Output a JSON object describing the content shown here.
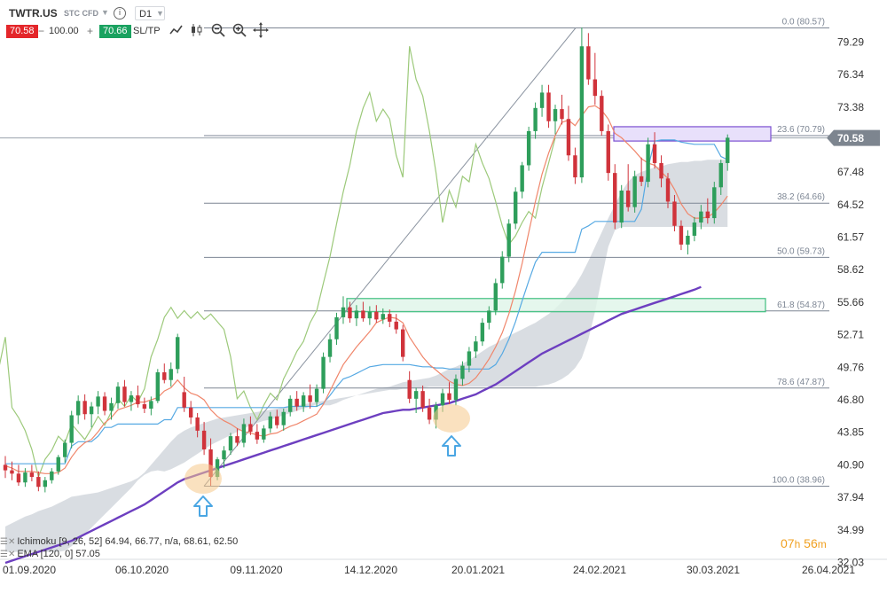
{
  "header": {
    "symbol": "TWTR.US",
    "instrument_type": "STC CFD",
    "timeframe": "D1",
    "bid": "70.58",
    "quantity": "100.00",
    "ask": "70.66",
    "sltp_label": "SL/TP",
    "icons": [
      "line-chart-icon",
      "candlestick-icon",
      "zoom-out-icon",
      "zoom-in-icon",
      "crosshair-icon"
    ]
  },
  "indicators": {
    "ichimoku": "Ichimoku [9, 26, 52] 64.94, 66.77, n/a, 68.61, 62.50",
    "ema": "EMA [120, 0] 57.05"
  },
  "timer": {
    "hours": "07",
    "h_unit": "h",
    "minutes": "56",
    "m_unit": "m"
  },
  "colors": {
    "bull": "#2e9e5b",
    "bear": "#d0333b",
    "tenkan": "#f0866b",
    "kijun": "#56a9e3",
    "chikou": "#9cc97a",
    "ema": "#6d3fc0",
    "cloud": "#c9cfd6",
    "fib": "#7d8694",
    "green_zone": "#3fbf7f",
    "purple_zone": "#7b4fd1",
    "price_tag": "#7d858f",
    "marker": "#f5c98a",
    "arrow": "#4aa6e3"
  },
  "chart_data": {
    "type": "candlestick",
    "title": "",
    "y_ticks": [
      79.29,
      76.34,
      73.38,
      70.43,
      67.48,
      64.52,
      61.57,
      58.62,
      55.66,
      52.71,
      49.76,
      46.8,
      43.85,
      40.9,
      37.94,
      34.99,
      32.03
    ],
    "x_ticks": [
      "01.09.2020",
      "06.10.2020",
      "09.11.2020",
      "14.12.2020",
      "20.01.2021",
      "24.02.2021",
      "30.03.2021",
      "26.04.2021"
    ],
    "ylim": [
      31.0,
      81.5
    ],
    "current_price": "70.58",
    "fibonacci": [
      {
        "level": "0.0",
        "price": "80.57"
      },
      {
        "level": "23.6",
        "price": "70.79"
      },
      {
        "level": "38.2",
        "price": "64.66"
      },
      {
        "level": "50.0",
        "price": "59.73"
      },
      {
        "level": "61.8",
        "price": "54.87"
      },
      {
        "level": "78.6",
        "price": "47.87"
      },
      {
        "level": "100.0",
        "price": "38.96"
      }
    ],
    "zones": [
      {
        "name": "supply",
        "from": 70.3,
        "to": 71.6
      },
      {
        "name": "support",
        "from": 54.8,
        "to": 56.0
      }
    ],
    "candles": [
      [
        40.9,
        41.7,
        39.7,
        40.4
      ],
      [
        40.4,
        41.2,
        39.5,
        40.1
      ],
      [
        40.1,
        40.9,
        39.0,
        39.3
      ],
      [
        39.3,
        40.6,
        38.9,
        40.2
      ],
      [
        40.2,
        40.9,
        39.4,
        39.8
      ],
      [
        39.8,
        40.3,
        38.5,
        38.9
      ],
      [
        38.9,
        39.8,
        38.4,
        39.5
      ],
      [
        39.5,
        40.6,
        39.2,
        40.3
      ],
      [
        40.3,
        41.8,
        40.0,
        41.6
      ],
      [
        41.6,
        43.2,
        41.1,
        42.9
      ],
      [
        42.9,
        45.8,
        42.4,
        45.4
      ],
      [
        45.4,
        47.2,
        44.6,
        46.7
      ],
      [
        46.7,
        47.3,
        45.0,
        45.5
      ],
      [
        45.5,
        46.6,
        44.3,
        46.2
      ],
      [
        46.2,
        47.6,
        45.5,
        47.1
      ],
      [
        47.1,
        47.5,
        45.4,
        45.8
      ],
      [
        45.8,
        47.0,
        45.0,
        46.5
      ],
      [
        46.5,
        48.4,
        46.0,
        48.0
      ],
      [
        48.0,
        48.6,
        46.2,
        46.6
      ],
      [
        46.6,
        47.6,
        45.8,
        47.2
      ],
      [
        47.2,
        48.1,
        46.1,
        46.4
      ],
      [
        46.4,
        47.0,
        45.6,
        46.0
      ],
      [
        46.0,
        47.1,
        45.4,
        46.7
      ],
      [
        46.7,
        49.6,
        46.5,
        49.3
      ],
      [
        49.3,
        50.1,
        48.3,
        48.6
      ],
      [
        48.6,
        50.2,
        48.0,
        49.6
      ],
      [
        49.6,
        52.8,
        49.2,
        52.5
      ],
      [
        47.5,
        48.9,
        45.7,
        46.1
      ],
      [
        46.1,
        46.7,
        44.6,
        45.2
      ],
      [
        45.2,
        45.6,
        43.4,
        44.0
      ],
      [
        44.0,
        44.8,
        41.8,
        42.3
      ],
      [
        42.3,
        43.3,
        39.0,
        39.8
      ],
      [
        39.8,
        41.6,
        39.5,
        41.4
      ],
      [
        41.4,
        42.6,
        40.6,
        42.2
      ],
      [
        42.2,
        43.8,
        41.8,
        43.5
      ],
      [
        43.5,
        44.2,
        42.6,
        42.9
      ],
      [
        42.9,
        45.1,
        42.5,
        44.6
      ],
      [
        44.6,
        45.3,
        43.6,
        43.9
      ],
      [
        43.9,
        44.6,
        42.8,
        43.2
      ],
      [
        43.2,
        44.5,
        42.9,
        44.2
      ],
      [
        44.2,
        45.7,
        43.8,
        45.3
      ],
      [
        45.3,
        45.9,
        44.2,
        44.5
      ],
      [
        44.5,
        46.0,
        44.0,
        45.7
      ],
      [
        45.7,
        47.2,
        45.3,
        46.9
      ],
      [
        46.9,
        47.6,
        45.8,
        46.2
      ],
      [
        46.2,
        47.5,
        45.7,
        47.2
      ],
      [
        47.2,
        48.2,
        46.0,
        46.6
      ],
      [
        46.6,
        48.2,
        46.2,
        47.8
      ],
      [
        47.8,
        51.1,
        47.4,
        50.7
      ],
      [
        50.7,
        52.8,
        50.2,
        52.3
      ],
      [
        52.3,
        54.7,
        51.8,
        54.3
      ],
      [
        54.3,
        56.2,
        53.7,
        55.2
      ],
      [
        55.2,
        55.7,
        53.8,
        54.2
      ],
      [
        54.2,
        55.4,
        53.5,
        54.9
      ],
      [
        54.9,
        55.7,
        53.9,
        54.2
      ],
      [
        54.2,
        55.3,
        53.6,
        54.8
      ],
      [
        54.8,
        55.4,
        53.8,
        54.1
      ],
      [
        54.1,
        55.1,
        53.7,
        54.6
      ],
      [
        54.6,
        55.0,
        53.4,
        53.9
      ],
      [
        53.9,
        54.6,
        52.8,
        53.2
      ],
      [
        53.2,
        53.6,
        50.3,
        50.7
      ],
      [
        48.6,
        49.4,
        46.5,
        46.9
      ],
      [
        46.9,
        47.9,
        45.6,
        47.6
      ],
      [
        47.6,
        48.1,
        45.7,
        46.1
      ],
      [
        46.1,
        46.9,
        44.6,
        45.0
      ],
      [
        45.0,
        46.6,
        44.2,
        46.3
      ],
      [
        46.3,
        47.8,
        45.7,
        47.4
      ],
      [
        47.4,
        48.4,
        46.4,
        46.8
      ],
      [
        46.8,
        49.1,
        46.3,
        48.7
      ],
      [
        48.7,
        50.3,
        48.1,
        49.9
      ],
      [
        49.9,
        51.6,
        49.3,
        51.2
      ],
      [
        51.2,
        52.6,
        50.6,
        52.1
      ],
      [
        52.1,
        54.2,
        51.7,
        53.8
      ],
      [
        53.8,
        55.3,
        53.2,
        54.9
      ],
      [
        54.9,
        57.8,
        54.5,
        57.4
      ],
      [
        57.4,
        60.3,
        56.9,
        59.8
      ],
      [
        59.8,
        63.2,
        59.3,
        62.8
      ],
      [
        62.8,
        66.1,
        62.3,
        65.7
      ],
      [
        65.7,
        68.4,
        65.1,
        68.1
      ],
      [
        68.1,
        71.6,
        67.6,
        71.2
      ],
      [
        71.2,
        73.8,
        70.5,
        73.3
      ],
      [
        73.3,
        75.4,
        72.5,
        74.7
      ],
      [
        74.7,
        75.4,
        71.5,
        72.1
      ],
      [
        72.1,
        73.6,
        70.9,
        73.2
      ],
      [
        73.2,
        74.5,
        71.8,
        72.3
      ],
      [
        72.3,
        73.5,
        68.5,
        69.0
      ],
      [
        69.0,
        69.7,
        66.4,
        67.0
      ],
      [
        67.0,
        80.6,
        66.5,
        78.9
      ],
      [
        78.9,
        80.1,
        75.4,
        75.9
      ],
      [
        75.9,
        78.3,
        73.6,
        74.4
      ],
      [
        74.4,
        74.9,
        70.8,
        71.2
      ],
      [
        71.2,
        71.8,
        66.7,
        67.4
      ],
      [
        67.4,
        68.2,
        62.3,
        62.9
      ],
      [
        62.9,
        66.3,
        62.4,
        65.8
      ],
      [
        65.8,
        68.2,
        63.9,
        64.3
      ],
      [
        64.3,
        67.6,
        63.8,
        67.1
      ],
      [
        67.1,
        68.8,
        66.2,
        66.6
      ],
      [
        66.6,
        70.6,
        66.1,
        70.0
      ],
      [
        70.0,
        71.1,
        67.8,
        68.3
      ],
      [
        68.3,
        69.0,
        66.1,
        66.9
      ],
      [
        66.9,
        67.4,
        64.2,
        64.8
      ],
      [
        64.8,
        65.4,
        62.1,
        62.6
      ],
      [
        62.6,
        63.1,
        60.4,
        60.9
      ],
      [
        60.9,
        62.2,
        60.0,
        61.7
      ],
      [
        61.7,
        63.4,
        61.2,
        62.9
      ],
      [
        62.9,
        64.5,
        62.3,
        63.9
      ],
      [
        63.9,
        65.1,
        62.8,
        63.3
      ],
      [
        63.3,
        66.6,
        62.8,
        66.1
      ],
      [
        66.1,
        68.6,
        65.4,
        68.3
      ],
      [
        68.3,
        70.9,
        67.6,
        70.6
      ]
    ],
    "tenkan": [
      40.8,
      40.6,
      40.3,
      40.3,
      40.3,
      40.2,
      40.1,
      40.1,
      40.2,
      40.6,
      41.6,
      42.4,
      42.9,
      43.2,
      43.9,
      44.7,
      45.2,
      45.9,
      46.1,
      46.3,
      46.6,
      46.6,
      46.8,
      47.0,
      47.6,
      47.9,
      48.6,
      47.9,
      47.4,
      47.2,
      46.8,
      45.9,
      45.3,
      44.9,
      44.6,
      44.2,
      43.9,
      43.8,
      43.6,
      43.5,
      43.7,
      43.8,
      44.1,
      44.4,
      44.6,
      44.9,
      45.2,
      45.5,
      46.4,
      47.6,
      48.8,
      50.0,
      50.8,
      51.6,
      52.3,
      53.0,
      53.8,
      54.1,
      54.3,
      54.2,
      53.8,
      52.5,
      51.6,
      50.7,
      50.0,
      49.5,
      49.0,
      48.5,
      48.2,
      48.1,
      48.3,
      48.8,
      49.6,
      50.5,
      51.6,
      52.9,
      54.6,
      56.7,
      59.2,
      62.0,
      64.8,
      67.3,
      69.2,
      70.8,
      72.0,
      72.2,
      71.7,
      72.6,
      73.4,
      73.5,
      73.1,
      72.3,
      71.0,
      70.6,
      70.0,
      69.4,
      68.7,
      68.3,
      68.1,
      67.5,
      66.9,
      65.9,
      64.6,
      63.7,
      63.3,
      63.3,
      63.4,
      63.8,
      64.5,
      65.3
    ],
    "kijun": [
      41.0,
      41.0,
      41.0,
      41.0,
      41.0,
      41.0,
      41.0,
      41.0,
      41.0,
      41.0,
      42.6,
      43.0,
      43.0,
      43.0,
      43.5,
      44.3,
      44.3,
      44.6,
      44.6,
      44.6,
      44.6,
      44.6,
      44.6,
      44.6,
      45.0,
      45.0,
      46.1,
      46.1,
      46.1,
      46.1,
      46.1,
      46.1,
      46.1,
      46.1,
      46.1,
      46.1,
      46.1,
      46.1,
      46.1,
      46.1,
      46.1,
      46.1,
      46.1,
      46.2,
      46.2,
      46.2,
      46.2,
      46.2,
      46.5,
      47.2,
      48.0,
      48.7,
      48.9,
      49.2,
      49.5,
      49.8,
      49.9,
      50.0,
      50.0,
      50.0,
      50.0,
      50.0,
      49.9,
      49.8,
      49.8,
      49.7,
      49.7,
      49.6,
      49.6,
      49.6,
      49.6,
      49.6,
      49.6,
      49.6,
      50.0,
      51.0,
      52.3,
      53.9,
      55.8,
      57.6,
      59.3,
      60.2,
      60.2,
      60.2,
      60.2,
      60.2,
      60.2,
      62.3,
      62.6,
      63.0,
      63.0,
      63.0,
      63.0,
      63.0,
      63.0,
      63.0,
      64.1,
      67.9,
      70.3,
      70.4,
      70.4,
      70.4,
      70.2,
      70.1,
      70.0,
      70.0,
      70.0,
      70.0,
      68.9,
      68.6
    ],
    "chikou": [
      40.4,
      40.1,
      39.3,
      40.2,
      39.8,
      38.9,
      39.5,
      40.3,
      41.6,
      42.9,
      45.4,
      46.7,
      45.5,
      46.2,
      47.1,
      45.8,
      46.5,
      48.0,
      46.6,
      47.2,
      46.4,
      46.0,
      46.7,
      49.3,
      48.6,
      49.6,
      52.5,
      46.1,
      45.2,
      44.0,
      42.3,
      39.8,
      41.4,
      42.2,
      43.5,
      42.9,
      44.6,
      43.9,
      43.2,
      44.2,
      45.3,
      44.5,
      45.7,
      46.9,
      46.2,
      47.2,
      46.6,
      47.8,
      50.7,
      52.3,
      54.3,
      55.2,
      54.2,
      54.9,
      54.2,
      54.8,
      54.1,
      54.6,
      53.9,
      53.2,
      50.7,
      46.9,
      47.6,
      46.1,
      45.0,
      46.3,
      47.4,
      46.8,
      48.7,
      49.9,
      51.2,
      52.1,
      53.8,
      54.9,
      57.4,
      59.8,
      62.8,
      65.7,
      68.1,
      71.2,
      73.3,
      74.7,
      72.1,
      73.2,
      72.3,
      69.0,
      67.0,
      78.9,
      75.9,
      74.4,
      71.2,
      67.4,
      62.9,
      65.8,
      64.3,
      67.1,
      66.6,
      70.0,
      68.3,
      66.9,
      64.8,
      62.6,
      60.9,
      61.7,
      62.9,
      63.9,
      63.3,
      66.1,
      68.3,
      70.6
    ],
    "span_a": [
      35.3,
      35.6,
      35.9,
      36.2,
      36.4,
      36.7,
      36.9,
      37.1,
      37.4,
      37.7,
      38.0,
      38.1,
      38.2,
      38.3,
      38.4,
      38.6,
      38.8,
      39.0,
      39.2,
      39.4,
      39.7,
      40.0,
      40.3,
      40.4,
      40.3,
      40.5,
      40.8,
      41.1,
      41.5,
      41.9,
      42.3,
      42.7,
      43.0,
      43.3,
      43.6,
      43.9,
      44.2,
      44.5,
      44.7,
      44.9,
      45.0,
      45.2,
      45.4,
      45.6,
      45.8,
      46.0,
      46.2,
      46.4,
      46.3,
      46.3,
      46.5,
      46.8,
      47.0,
      47.2,
      47.4,
      47.6,
      47.8,
      47.9,
      48.0,
      48.2,
      48.4,
      48.5,
      48.6,
      48.7,
      48.8,
      49.0,
      49.3,
      49.6,
      49.8,
      50.1,
      50.4,
      50.8,
      51.2,
      51.6,
      51.9,
      52.3,
      52.6,
      52.9,
      53.2,
      53.5,
      53.8,
      54.2,
      54.6,
      55.1,
      55.7,
      56.4,
      57.2,
      58.2,
      59.4,
      60.7,
      62.0,
      63.3,
      64.5,
      65.7,
      66.6,
      67.2,
      67.5,
      67.7,
      67.9,
      68.0,
      68.2,
      68.3,
      68.4,
      68.4,
      68.5,
      68.5,
      68.6,
      68.6,
      68.6,
      68.6
    ],
    "span_b": [
      33.0,
      33.0,
      33.0,
      33.0,
      33.0,
      33.0,
      33.0,
      33.0,
      33.0,
      33.1,
      33.5,
      34.0,
      34.6,
      35.2,
      35.8,
      36.4,
      37.0,
      37.6,
      38.2,
      38.8,
      39.5,
      40.2,
      40.9,
      41.6,
      42.3,
      43.0,
      43.6,
      44.0,
      44.3,
      44.5,
      44.7,
      44.9,
      45.1,
      45.2,
      45.3,
      45.4,
      45.5,
      45.6,
      45.7,
      45.8,
      45.9,
      46.0,
      46.1,
      46.2,
      46.3,
      46.4,
      46.5,
      46.6,
      46.7,
      46.8,
      46.9,
      47.0,
      47.1,
      47.2,
      47.3,
      47.4,
      47.5,
      47.6,
      47.7,
      47.7,
      47.8,
      47.8,
      47.9,
      47.9,
      48.0,
      48.0,
      48.0,
      48.0,
      48.0,
      48.0,
      48.0,
      48.0,
      48.0,
      48.0,
      48.0,
      48.0,
      48.0,
      48.0,
      48.0,
      48.0,
      48.0,
      48.1,
      48.2,
      48.4,
      48.7,
      49.1,
      49.7,
      50.6,
      52.3,
      54.8,
      57.8,
      60.7,
      62.2,
      62.5,
      62.5,
      62.5,
      62.5,
      62.5,
      62.5,
      62.5,
      62.5,
      62.5,
      62.5,
      62.5,
      62.5,
      62.5,
      62.5,
      62.5,
      62.5,
      62.5
    ],
    "ema": [
      32.0,
      32.2,
      32.4,
      32.6,
      32.8,
      33.0,
      33.2,
      33.4,
      33.6,
      33.8,
      34.0,
      34.3,
      34.6,
      34.9,
      35.2,
      35.5,
      35.8,
      36.1,
      36.4,
      36.7,
      37.0,
      37.3,
      37.7,
      38.1,
      38.5,
      38.9,
      39.3,
      39.6,
      39.8,
      40.0,
      40.2,
      40.4,
      40.6,
      40.8,
      41.0,
      41.2,
      41.4,
      41.6,
      41.8,
      42.0,
      42.2,
      42.4,
      42.6,
      42.8,
      43.0,
      43.2,
      43.4,
      43.6,
      43.8,
      44.0,
      44.2,
      44.4,
      44.6,
      44.8,
      45.0,
      45.2,
      45.4,
      45.6,
      45.7,
      45.8,
      45.9,
      45.9,
      46.0,
      46.1,
      46.2,
      46.3,
      46.4,
      46.5,
      46.7,
      46.9,
      47.1,
      47.3,
      47.6,
      47.9,
      48.2,
      48.6,
      49.0,
      49.4,
      49.8,
      50.2,
      50.6,
      51.0,
      51.3,
      51.6,
      51.9,
      52.2,
      52.5,
      52.8,
      53.1,
      53.4,
      53.7,
      54.0,
      54.3,
      54.6,
      54.8,
      55.0,
      55.2,
      55.4,
      55.6,
      55.8,
      56.0,
      56.2,
      56.4,
      56.6,
      56.8,
      57.05
    ]
  }
}
